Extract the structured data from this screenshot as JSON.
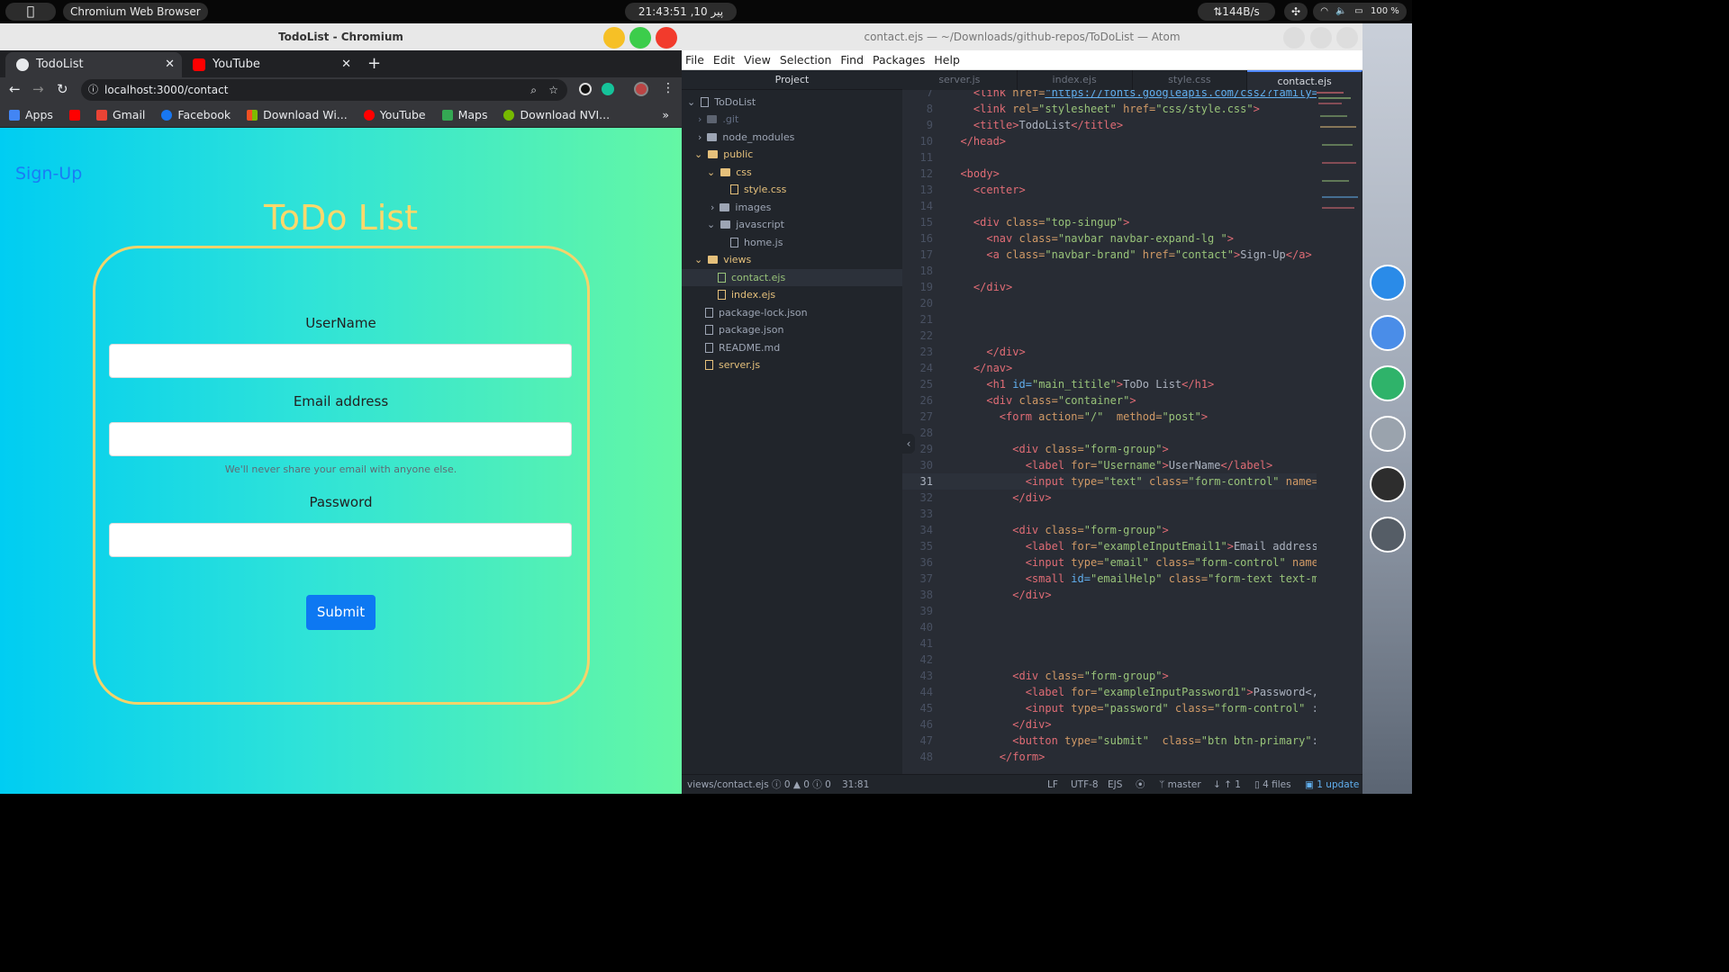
{
  "topbar": {
    "app_name": "Chromium Web Browser",
    "clock": "21:43:51 ,10 پیر اگست",
    "net": "⇅144B/s",
    "battery": "100 %"
  },
  "chrome": {
    "title": "TodoList - Chromium",
    "tabs": [
      {
        "label": "TodoList"
      },
      {
        "label": "YouTube"
      }
    ],
    "url": "localhost:3000/contact",
    "bookmarks": [
      "Apps",
      "Gmail",
      "Facebook",
      "Download Wi...",
      "YouTube",
      "Maps",
      "Download NVI..."
    ],
    "more": "»"
  },
  "page": {
    "signup": "Sign-Up",
    "title": "ToDo List",
    "username_label": "UserName",
    "email_label": "Email address",
    "email_hint": "We'll never share your email with anyone else.",
    "password_label": "Password",
    "submit": "Submit"
  },
  "atom": {
    "title": "contact.ejs — ~/Downloads/github-repos/ToDoList — Atom",
    "menu": [
      "File",
      "Edit",
      "View",
      "Selection",
      "Find",
      "Packages",
      "Help"
    ],
    "tree_header": "Project",
    "tree": [
      "ToDoList",
      ".git",
      "node_modules",
      "public",
      "css",
      "style.css",
      "images",
      "javascript",
      "home.js",
      "views",
      "contact.ejs",
      "index.ejs",
      "package-lock.json",
      "package.json",
      "README.md",
      "server.js"
    ],
    "tabs": [
      "server.js",
      "index.ejs",
      "style.css",
      "contact.ejs"
    ],
    "status": {
      "path": "views/contact.ejs",
      "diag": "0 ▲ 0 ⓘ 0",
      "cursor": "31:81",
      "eol": "LF",
      "enc": "UTF-8",
      "grammar": "EJS",
      "branch": "master",
      "sync": "↓ ↑ 1",
      "files": "4 files",
      "update": "1 update"
    }
  },
  "colors": {
    "gradient_start": "#00cdf2",
    "gradient_end": "#64f7a4",
    "title_yellow": "#ffd86b",
    "button_blue": "#0d78f2",
    "editor_bg": "#282c34"
  }
}
